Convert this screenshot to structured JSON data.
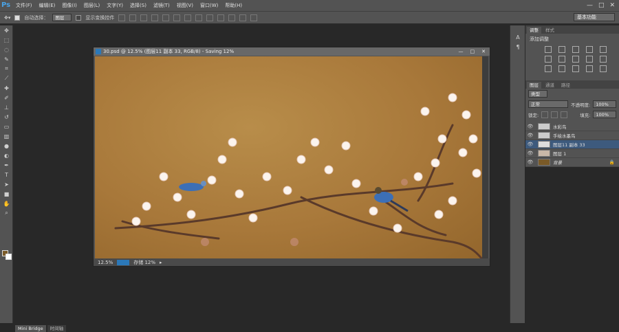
{
  "app": {
    "logo": "Ps"
  },
  "menu": [
    "文件(F)",
    "编辑(E)",
    "图像(I)",
    "图层(L)",
    "文字(Y)",
    "选择(S)",
    "滤镜(T)",
    "视图(V)",
    "窗口(W)",
    "帮助(H)"
  ],
  "window_controls": [
    "—",
    "□",
    "✕"
  ],
  "options_bar": {
    "auto_select_label": "自动选择：",
    "auto_select_value": "图层",
    "show_transform_label": "显示变换控件",
    "workspace": "基本功能"
  },
  "document": {
    "title": "30.psd @ 12.5% (图层11 副本 33, RGB/8) - Saving 12%",
    "zoom": "12.5%",
    "status": "存储 12%"
  },
  "panels": {
    "adjust_tabs": [
      "调整",
      "样式"
    ],
    "adjust_title": "添加调整",
    "layers_tabs": [
      "图层",
      "通道",
      "路径"
    ],
    "filter_kind": "类型",
    "blend_mode": "正常",
    "opacity_label": "不透明度:",
    "opacity_value": "100%",
    "lock_label": "锁定:",
    "fill_label": "填充:",
    "fill_value": "100%",
    "layers": [
      {
        "name": "水彩鸟",
        "selected": false
      },
      {
        "name": "手绘水墨鸟",
        "selected": false
      },
      {
        "name": "图层11 副本 33",
        "selected": true
      },
      {
        "name": "图层 1",
        "selected": false
      },
      {
        "name": "背景",
        "selected": false
      }
    ]
  },
  "bottom_tabs": [
    "Mini Bridge",
    "时间轴"
  ],
  "colors": {
    "fg": "#7a5a28",
    "bg": "#ffffff",
    "accent": "#2b78b8"
  }
}
